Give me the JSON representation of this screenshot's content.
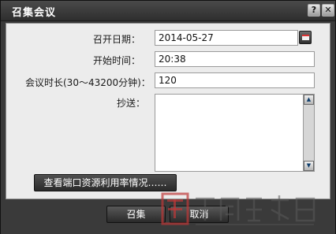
{
  "window": {
    "title": "召集会议",
    "help_glyph": "?",
    "close_glyph": "✕"
  },
  "form": {
    "date_label": "召开日期：",
    "date_value": "2014-05-27",
    "start_label": "开始时间：",
    "start_value": "20:38",
    "duration_label": "会议时长(30～43200分钟)：",
    "duration_value": "120",
    "cc_label": "抄送：",
    "cc_value": ""
  },
  "buttons": {
    "query_label": "查看端口资源利用率情况……",
    "ok_label": "召集",
    "cancel_label": "取消"
  },
  "icons": {
    "calendar": "calendar-icon",
    "scroll_up": "scroll-up-icon",
    "scroll_down": "scroll-down-icon"
  },
  "colors": {
    "panel": "#ececec",
    "frame": "#3a3a3a",
    "watermark": "#be3737"
  }
}
